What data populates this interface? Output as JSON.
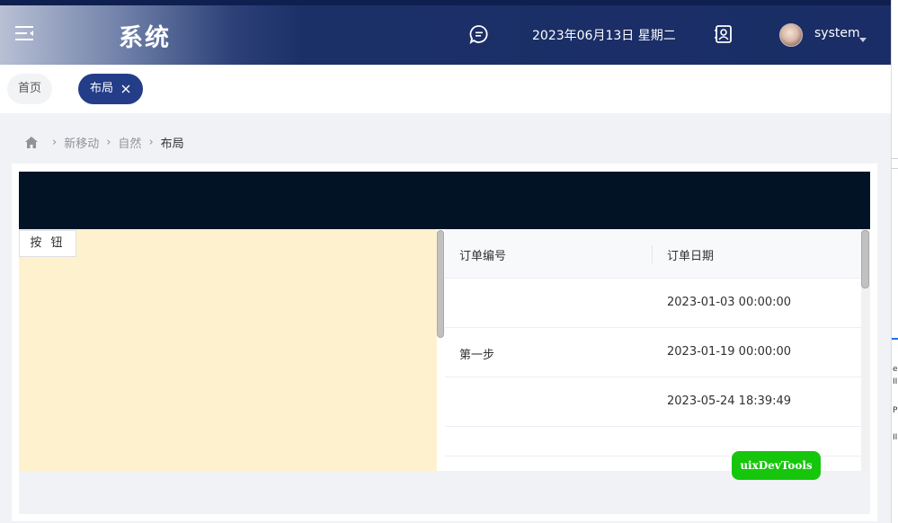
{
  "header": {
    "title": "系统",
    "date": "2023年06月13日 星期二",
    "username": "system",
    "icons": [
      "menu-fold-icon",
      "message-icon",
      "contact-icon",
      "caret-down-icon"
    ]
  },
  "tabs": [
    {
      "label": "首页"
    },
    {
      "label": "布局"
    }
  ],
  "breadcrumb": [
    "新移动",
    "自然",
    "布局"
  ],
  "left_pane": {
    "button_label": "按 钮"
  },
  "table": {
    "columns": [
      "订单编号",
      "订单日期"
    ],
    "rows": [
      {
        "order_no": "",
        "order_date": "2023-01-03 00:00:00"
      },
      {
        "order_no": "第一步",
        "order_date": "2023-01-19 00:00:00"
      },
      {
        "order_no": "",
        "order_date": "2023-05-24 18:39:49"
      },
      {
        "order_no": "",
        "order_date": ""
      }
    ]
  },
  "devtools": {
    "label": "uixDevTools"
  },
  "edge_panel": {
    "glyphs": [
      "e",
      "II",
      "P",
      "II"
    ]
  },
  "colors": {
    "header_dark": "#1a2d66",
    "active_tab": "#233d88",
    "dark_bar": "#021326",
    "left_pane": "#fef1cd",
    "devtools_green": "#16c60c"
  }
}
